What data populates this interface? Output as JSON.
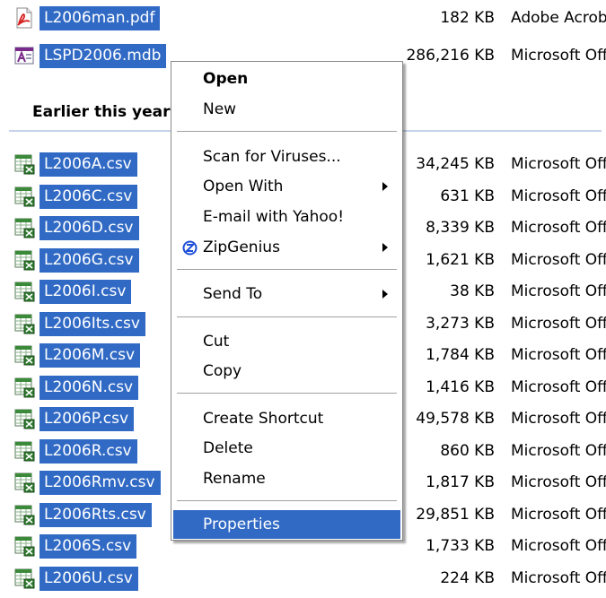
{
  "group_header": "Earlier this year",
  "files_top": [
    {
      "name": "L2006man.pdf",
      "size": "182 KB",
      "type": "Adobe Acrobat Document",
      "icon": "pdf-icon"
    },
    {
      "name": "LSPD2006.mdb",
      "size": "286,216 KB",
      "type": "Microsoft Office Access Application",
      "icon": "access-db-icon"
    }
  ],
  "files_csv": [
    {
      "name": "L2006A.csv",
      "size": "34,245 KB",
      "type": "Microsoft Office Excel Comma Separated Values File",
      "icon": "excel-csv-icon"
    },
    {
      "name": "L2006C.csv",
      "size": "631 KB",
      "type": "Microsoft Office Excel Comma Separated Values File",
      "icon": "excel-csv-icon"
    },
    {
      "name": "L2006D.csv",
      "size": "8,339 KB",
      "type": "Microsoft Office Excel Comma Separated Values File",
      "icon": "excel-csv-icon"
    },
    {
      "name": "L2006G.csv",
      "size": "1,621 KB",
      "type": "Microsoft Office Excel Comma Separated Values File",
      "icon": "excel-csv-icon"
    },
    {
      "name": "L2006I.csv",
      "size": "38 KB",
      "type": "Microsoft Office Excel Comma Separated Values File",
      "icon": "excel-csv-icon"
    },
    {
      "name": "L2006Its.csv",
      "size": "3,273 KB",
      "type": "Microsoft Office Excel Comma Separated Values File",
      "icon": "excel-csv-icon"
    },
    {
      "name": "L2006M.csv",
      "size": "1,784 KB",
      "type": "Microsoft Office Excel Comma Separated Values File",
      "icon": "excel-csv-icon"
    },
    {
      "name": "L2006N.csv",
      "size": "1,416 KB",
      "type": "Microsoft Office Excel Comma Separated Values File",
      "icon": "excel-csv-icon"
    },
    {
      "name": "L2006P.csv",
      "size": "49,578 KB",
      "type": "Microsoft Office Excel Comma Separated Values File",
      "icon": "excel-csv-icon"
    },
    {
      "name": "L2006R.csv",
      "size": "860 KB",
      "type": "Microsoft Office Excel Comma Separated Values File",
      "icon": "excel-csv-icon"
    },
    {
      "name": "L2006Rmv.csv",
      "size": "1,817 KB",
      "type": "Microsoft Office Excel Comma Separated Values File",
      "icon": "excel-csv-icon"
    },
    {
      "name": "L2006Rts.csv",
      "size": "29,851 KB",
      "type": "Microsoft Office Excel Comma Separated Values File",
      "icon": "excel-csv-icon"
    },
    {
      "name": "L2006S.csv",
      "size": "1,733 KB",
      "type": "Microsoft Office Excel Comma Separated Values File",
      "icon": "excel-csv-icon"
    },
    {
      "name": "L2006U.csv",
      "size": "224 KB",
      "type": "Microsoft Office Excel Comma Separated Values File",
      "icon": "excel-csv-icon"
    }
  ],
  "context_menu": {
    "open": "Open",
    "new": "New",
    "scan": "Scan for Viruses...",
    "open_with": "Open With",
    "email_yahoo": "E-mail with Yahoo!",
    "zipgenius": "ZipGenius",
    "zipgenius_icon": "zipgenius-icon",
    "send_to": "Send To",
    "cut": "Cut",
    "copy": "Copy",
    "create_shortcut": "Create Shortcut",
    "delete": "Delete",
    "rename": "Rename",
    "properties": "Properties"
  },
  "colors": {
    "selection": "#316ac5",
    "group_line": "#c5d2ea",
    "menu_border": "#8a8a8a"
  }
}
